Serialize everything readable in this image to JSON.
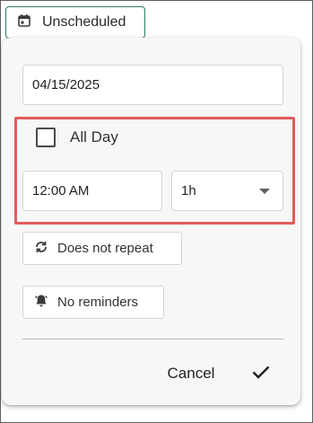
{
  "trigger": {
    "label": "Unscheduled",
    "icon": "calendar-icon"
  },
  "popup": {
    "date_value": "04/15/2025",
    "all_day": {
      "label": "All Day",
      "checked": false
    },
    "time_value": "12:00 AM",
    "duration_value": "1h",
    "repeat": {
      "label": "Does not repeat",
      "icon": "repeat-icon"
    },
    "reminders": {
      "label": "No reminders",
      "icon": "bell-icon"
    },
    "actions": {
      "cancel_label": "Cancel",
      "confirm_icon": "checkmark-icon"
    }
  },
  "colors": {
    "trigger_border": "#2e7d5b",
    "highlight_border": "#e35b5b",
    "popup_background": "#f7f7f7"
  }
}
